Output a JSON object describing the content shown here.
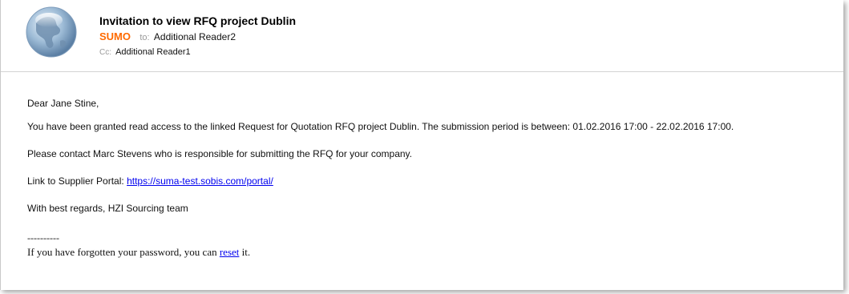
{
  "email": {
    "subject": "Invitation to view RFQ project Dublin",
    "sender": "SUMO",
    "to_label": "to:",
    "to": "Additional Reader2",
    "cc_label": "Cc:",
    "cc": "Additional Reader1",
    "avatar_icon": "globe-icon"
  },
  "body": {
    "greeting": "Dear Jane Stine,",
    "paragraph_access": "You have been granted read access to the linked Request for Quotation RFQ project Dublin. The submission period is between: 01.02.2016 17:00 - 22.02.2016 17:00.",
    "paragraph_contact": "Please contact Marc Stevens who is responsible for submitting the RFQ for your company.",
    "portal_label": "Link to Supplier Portal: ",
    "portal_url": "https://suma-test.sobis.com/portal/",
    "closing": "With best regards, HZI Sourcing team",
    "separator": "----------",
    "footer_prefix": "If you have forgotten your password, you can ",
    "footer_link": "reset",
    "footer_suffix": " it."
  },
  "colors": {
    "sender": "#ff6a00",
    "link": "#0000ee",
    "muted": "#9a9a9a"
  }
}
